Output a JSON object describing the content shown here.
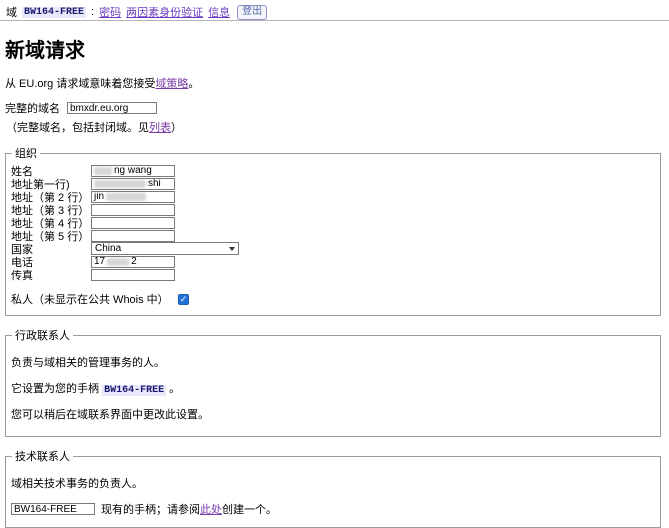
{
  "topbar": {
    "prefix": "域",
    "handle": "BW164-FREE",
    "separator": ":",
    "links": [
      "密码",
      "两因素身份验证",
      "信息"
    ],
    "logout": "登出"
  },
  "intro": {
    "title": "新域请求",
    "text_prefix": "从 EU.org 请求域意味着您接受",
    "policy_link": "域策略",
    "text_suffix": "。"
  },
  "domain": {
    "label": "完整的域名",
    "value": "bmxdr.eu.org",
    "note_prefix": "（完整域名，包括封闭域。见",
    "note_link": "列表",
    "note_suffix": "）"
  },
  "organization": {
    "legend": "组织",
    "labels": {
      "name": "姓名",
      "addr1": "地址第一行)",
      "addr2": "地址（第 2 行）",
      "addr3": "地址（第 3 行）",
      "addr4": "地址（第 4 行）",
      "addr5": "地址（第 5 行）",
      "country": "国家",
      "phone": "电话",
      "fax": "传真"
    },
    "values": {
      "name_visible": "ng wang",
      "addr1_visible": "shi",
      "addr2_visible": "jin",
      "country": "China",
      "phone_start": "17",
      "phone_end": "2"
    },
    "private_label": "私人（未显示在公共 Whois 中）",
    "private_checked": true
  },
  "admin": {
    "legend": "行政联系人",
    "line1": "负责与域相关的管理事务的人。",
    "line2_prefix": "它设置为您的手柄 ",
    "handle": "BW164-FREE",
    "line2_suffix": " 。",
    "line3": "您可以稍后在域联系界面中更改此设置。"
  },
  "tech": {
    "legend": "技术联系人",
    "line1": "域相关技术事务的负责人。",
    "handle_value": "BW164-FREE",
    "hint_prefix": "现有的手柄；请参阅",
    "hint_link": "此处",
    "hint_suffix": "创建一个。"
  },
  "colors": {
    "link": "#7a3da8",
    "topbar_link": "#6a3bc0",
    "handle_bg": "#e8e8fa",
    "handle_fg": "#18186e",
    "checkbox_blue": "#2272d8"
  }
}
